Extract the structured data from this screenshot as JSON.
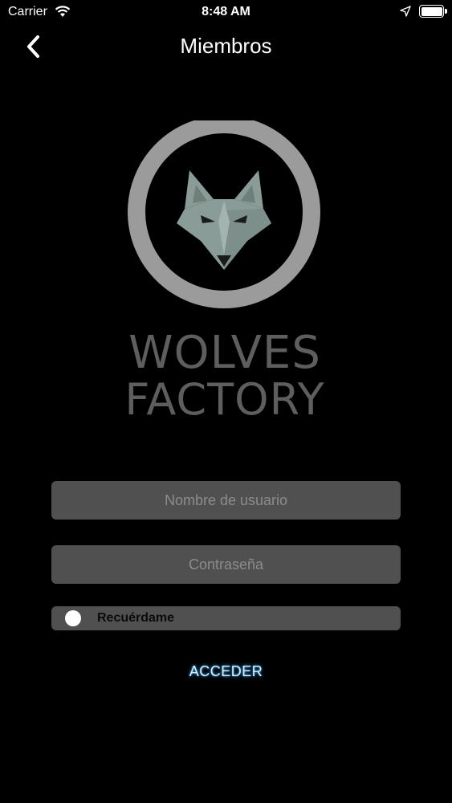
{
  "status_bar": {
    "carrier": "Carrier",
    "time": "8:48 AM"
  },
  "nav": {
    "title": "Miembros",
    "back_icon": "chevron-left-icon"
  },
  "logo": {
    "line1": "WOLVES",
    "line2": "FACTORY",
    "ring_color": "#9b9b9b",
    "wolf_color": "#8a9c97",
    "text_color": "#5e5e5e"
  },
  "form": {
    "username_placeholder": "Nombre de usuario",
    "password_placeholder": "Contraseña",
    "remember_label": "Recuérdame",
    "submit_label": "ACCEDER"
  },
  "colors": {
    "background": "#000000",
    "field_bg": "#505050",
    "accent_glow": "#2f8fd6"
  }
}
